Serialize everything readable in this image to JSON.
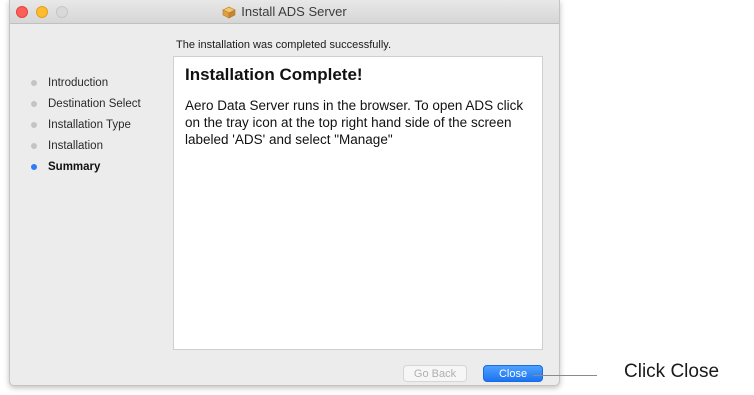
{
  "window": {
    "title": "Install ADS Server",
    "icon": "package-icon"
  },
  "status_line": "The installation was completed successfully.",
  "sidebar": {
    "items": [
      {
        "label": "Introduction",
        "active": false
      },
      {
        "label": "Destination Select",
        "active": false
      },
      {
        "label": "Installation Type",
        "active": false
      },
      {
        "label": "Installation",
        "active": false
      },
      {
        "label": "Summary",
        "active": true
      }
    ]
  },
  "content": {
    "heading": "Installation Complete!",
    "body": "Aero Data Server runs in the browser. To open ADS click on the tray icon at the top right hand side of the screen labeled 'ADS' and select \"Manage\""
  },
  "buttons": {
    "back_label": "Go Back",
    "close_label": "Close"
  },
  "annotation": {
    "text": "Click Close"
  },
  "colors": {
    "accent": "#2c7ef7",
    "traffic_close": "#fe5f57",
    "traffic_minimize": "#febc2e"
  }
}
